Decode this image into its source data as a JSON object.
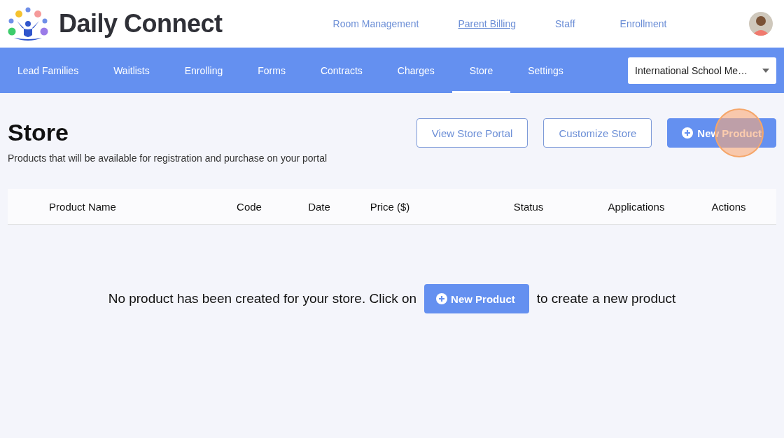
{
  "brand": {
    "name": "Daily Connect"
  },
  "top_nav": [
    {
      "label": "Room Management",
      "selected": false
    },
    {
      "label": "Parent Billing",
      "selected": true
    },
    {
      "label": "Staff",
      "selected": false
    },
    {
      "label": "Enrollment",
      "selected": false
    }
  ],
  "tabs": [
    {
      "label": "Lead Families",
      "selected": false
    },
    {
      "label": "Waitlists",
      "selected": false
    },
    {
      "label": "Enrolling",
      "selected": false
    },
    {
      "label": "Forms",
      "selected": false
    },
    {
      "label": "Contracts",
      "selected": false
    },
    {
      "label": "Charges",
      "selected": false
    },
    {
      "label": "Store",
      "selected": true
    },
    {
      "label": "Settings",
      "selected": false
    }
  ],
  "school_select": {
    "value": "International School Me…"
  },
  "page": {
    "title": "Store",
    "subtitle": "Products that will be available for registration and purchase on your portal"
  },
  "actions": [
    {
      "label": "View Store Portal",
      "kind": "outline"
    },
    {
      "label": "Customize Store",
      "kind": "outline"
    },
    {
      "label": "New Product",
      "kind": "primary",
      "clicked": true
    }
  ],
  "table": {
    "columns": [
      "Product Name",
      "Code",
      "Date",
      "Price ($)",
      "Status",
      "Applications",
      "Actions"
    ]
  },
  "empty_state": {
    "before": "No product has been created for your store. Click on",
    "button": "New Product",
    "after": "to create a new product"
  }
}
